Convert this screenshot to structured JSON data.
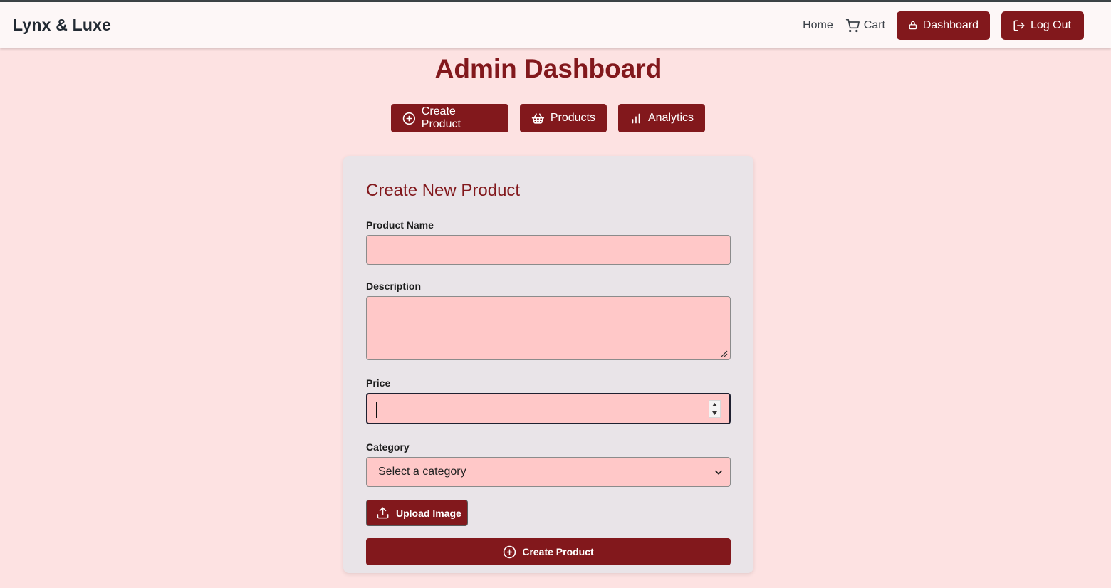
{
  "navbar": {
    "brand": "Lynx & Luxe",
    "home_label": "Home",
    "cart_label": "Cart",
    "dashboard_label": "Dashboard",
    "logout_label": "Log Out"
  },
  "page": {
    "title": "Admin Dashboard"
  },
  "tabs": [
    {
      "label": "Create Product",
      "icon": "plus-circle-icon"
    },
    {
      "label": "Products",
      "icon": "basket-icon"
    },
    {
      "label": "Analytics",
      "icon": "bar-chart-icon"
    }
  ],
  "form": {
    "title": "Create New Product",
    "fields": {
      "name": {
        "label": "Product Name",
        "value": ""
      },
      "description": {
        "label": "Description",
        "value": ""
      },
      "price": {
        "label": "Price",
        "value": ""
      },
      "category": {
        "label": "Category",
        "selected": "Select a category"
      }
    },
    "upload_label": "Upload Image",
    "submit_label": "Create Product"
  },
  "colors": {
    "accent": "#82181c",
    "background": "#fde2e2",
    "card": "#e9e4e8",
    "input": "#ffc8c8"
  }
}
